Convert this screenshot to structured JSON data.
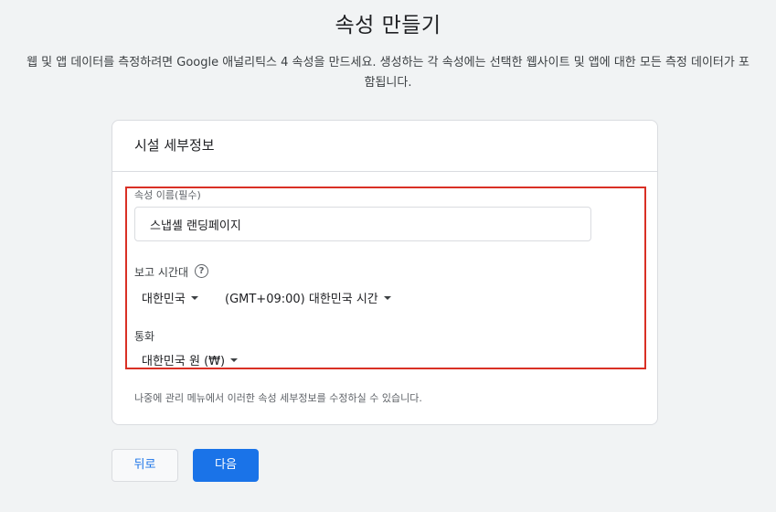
{
  "header": {
    "title": "속성 만들기",
    "description": "웹 및 앱 데이터를 측정하려면 Google 애널리틱스 4 속성을 만드세요. 생성하는 각 속성에는 선택한 웹사이트 및 앱에 대한 모든 측정 데이터가 포함됩니다."
  },
  "card": {
    "title": "시설 세부정보",
    "property_name": {
      "label": "속성 이름(필수)",
      "value": "스냅셸 랜딩페이지"
    },
    "timezone": {
      "label": "보고 시간대",
      "help_icon": "help-circle-icon",
      "country": "대한민국",
      "zone": "(GMT+09:00) 대한민국 시간"
    },
    "currency": {
      "label": "통화",
      "value": "대한민국 원 (₩)"
    },
    "footnote": "나중에 관리 메뉴에서 이러한 속성 세부정보를 수정하실 수 있습니다."
  },
  "buttons": {
    "back": "뒤로",
    "next": "다음"
  },
  "colors": {
    "accent": "#1a73e8",
    "highlight": "#d93025",
    "background": "#f1f3f4"
  }
}
